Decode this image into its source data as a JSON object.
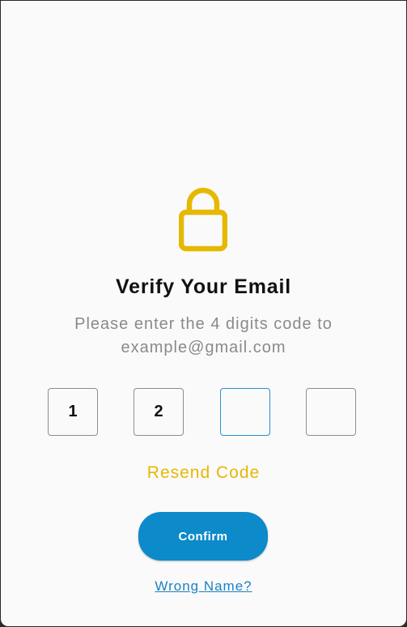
{
  "colors": {
    "accent_yellow": "#e6b800",
    "primary_blue": "#0c8ac9",
    "link_blue": "#1a82c2",
    "active_border": "#2b8fd0"
  },
  "icon": "lock-icon",
  "title": "Verify Your Email",
  "subtitle_line1": "Please enter the 4 digits code to",
  "subtitle_line2": "example@gmail.com",
  "code": {
    "digits": [
      "1",
      "2",
      "",
      ""
    ],
    "active_index": 2
  },
  "resend_label": "Resend Code",
  "confirm_label": "Confirm",
  "wrong_name_label": "Wrong Name?"
}
